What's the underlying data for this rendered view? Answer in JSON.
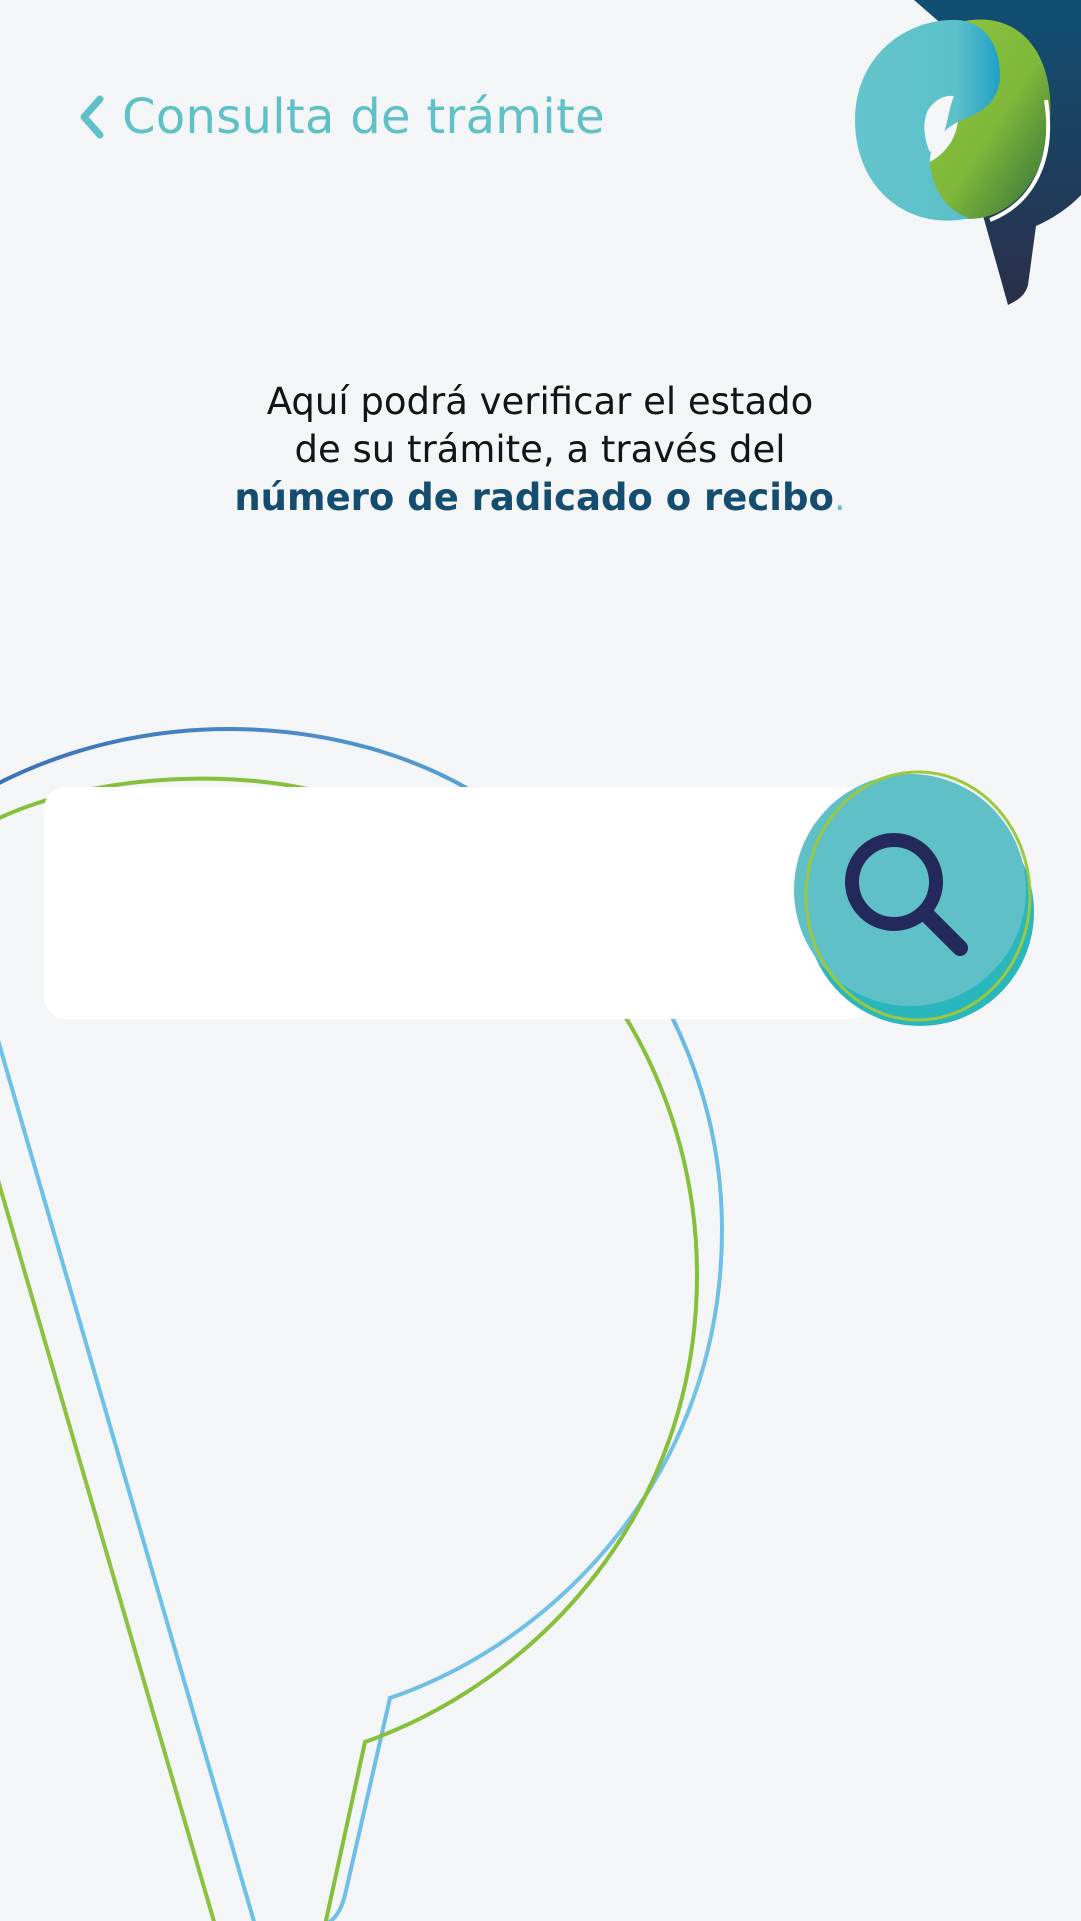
{
  "header": {
    "title": "Consulta de trámite",
    "back_icon": "chevron-left-icon"
  },
  "logo": {
    "icon": "brand-logo-icon"
  },
  "intro": {
    "line1": "Aquí podrá verificar el estado",
    "line2": "de su trámite, a través del",
    "highlight": "número de radicado o recibo",
    "suffix": "."
  },
  "search": {
    "value": "",
    "placeholder": "",
    "button_icon": "search-icon"
  },
  "colors": {
    "background": "#f4f5f6",
    "accent_teal": "#5fc0c8",
    "accent_green": "#8cc13f",
    "accent_blue": "#3d74b8",
    "highlight_navy": "#154d70",
    "icon_navy": "#23295a"
  }
}
